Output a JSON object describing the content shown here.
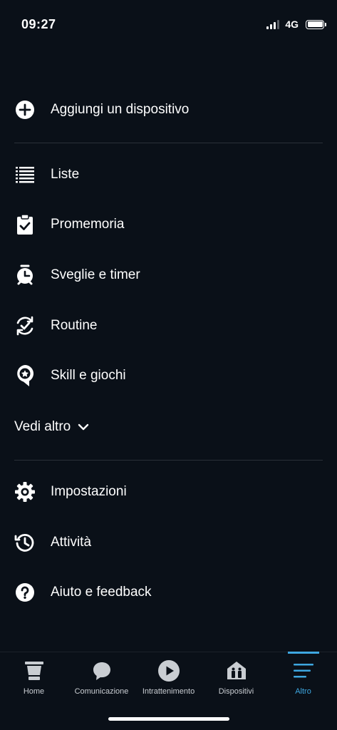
{
  "status_bar": {
    "time": "09:27",
    "network": "4G"
  },
  "menu": {
    "add_device": {
      "label": "Aggiungi un dispositivo",
      "icon": "plus-circle-icon"
    },
    "items": [
      {
        "label": "Liste",
        "icon": "list-icon"
      },
      {
        "label": "Promemoria",
        "icon": "clipboard-check-icon"
      },
      {
        "label": "Sveglie e timer",
        "icon": "alarm-clock-icon"
      },
      {
        "label": "Routine",
        "icon": "routine-check-icon"
      },
      {
        "label": "Skill e giochi",
        "icon": "skill-star-icon"
      }
    ],
    "see_more": "Vedi altro",
    "settings_items": [
      {
        "label": "Impostazioni",
        "icon": "gear-icon"
      },
      {
        "label": "Attività",
        "icon": "history-icon"
      },
      {
        "label": "Aiuto e feedback",
        "icon": "help-icon"
      }
    ]
  },
  "tab_bar": {
    "tabs": [
      {
        "label": "Home",
        "icon": "home-echo-icon",
        "active": false
      },
      {
        "label": "Comunicazione",
        "icon": "chat-bubble-icon",
        "active": false
      },
      {
        "label": "Intrattenimento",
        "icon": "play-icon",
        "active": false
      },
      {
        "label": "Dispositivi",
        "icon": "devices-house-icon",
        "active": false
      },
      {
        "label": "Altro",
        "icon": "menu-lines-icon",
        "active": true
      }
    ],
    "active_color": "#3ea7e0"
  }
}
